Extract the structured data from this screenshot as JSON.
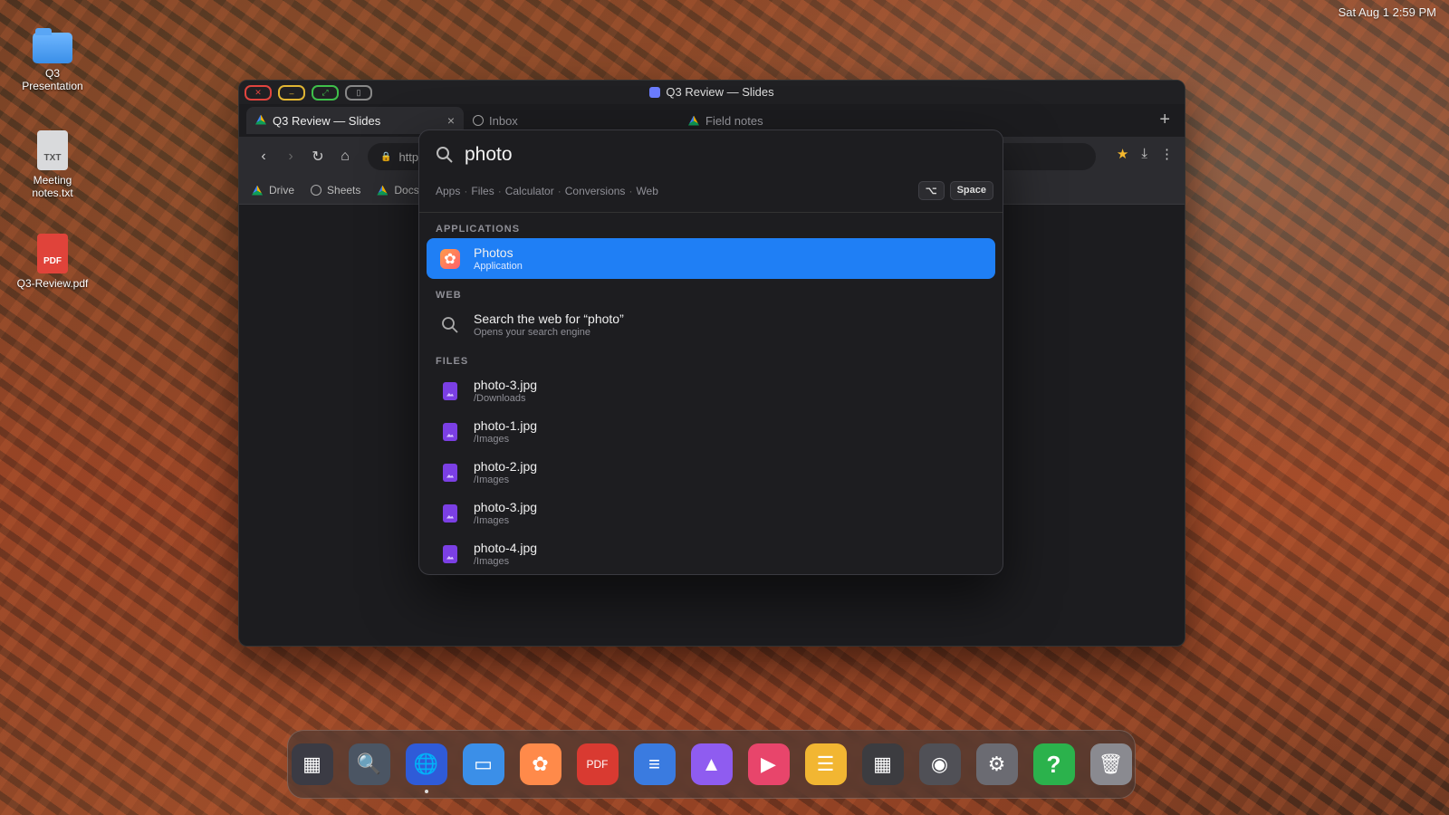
{
  "menubar": {
    "clock": "Sat Aug 1 2:59 PM"
  },
  "desktop": {
    "icons": [
      {
        "label": "Q3 Presentation",
        "kind": "folder"
      },
      {
        "label": "Meeting notes.txt",
        "kind": "txt",
        "badge": "TXT"
      },
      {
        "label": "Q3-Review.pdf",
        "kind": "pdf",
        "badge": "PDF"
      }
    ]
  },
  "window": {
    "title": "Q3 Review — Slides",
    "tabs": [
      {
        "label": "Q3 Review — Slides",
        "icon": "google-drive-icon"
      },
      {
        "label": "Inbox",
        "icon": "globe-icon"
      },
      {
        "label": "Field notes",
        "icon": "google-drive-icon"
      }
    ],
    "url": "https:",
    "bookmarks": [
      {
        "label": "Drive",
        "icon": "google-drive-icon"
      },
      {
        "label": "Sheets",
        "icon": "globe-icon"
      },
      {
        "label": "Docs",
        "icon": "google-drive-icon"
      }
    ]
  },
  "spotlight": {
    "query": "photo",
    "filters": [
      "Apps",
      "Files",
      "Calculator",
      "Conversions",
      "Web"
    ],
    "shortcut": {
      "modifier": "⌥",
      "key": "Space"
    },
    "sections": {
      "applications": "APPLICATIONS",
      "web": "WEB",
      "files": "FILES"
    },
    "app_result": {
      "title": "Photos",
      "subtitle": "Application"
    },
    "web_result": {
      "title": "Search the web for “photo”",
      "subtitle": "Opens your search engine"
    },
    "file_results": [
      {
        "name": "photo-3.jpg",
        "path": "/Downloads"
      },
      {
        "name": "photo-1.jpg",
        "path": "/Images"
      },
      {
        "name": "photo-2.jpg",
        "path": "/Images"
      },
      {
        "name": "photo-3.jpg",
        "path": "/Images"
      },
      {
        "name": "photo-4.jpg",
        "path": "/Images"
      }
    ],
    "accent": "#1f7ff5"
  },
  "dock": {
    "items": [
      {
        "name": "launchpad-icon",
        "glyph": "▦",
        "color": "#3b3b44"
      },
      {
        "name": "finder-search-icon",
        "glyph": "🔍",
        "color": "#4b5563"
      },
      {
        "name": "browser-globe-icon",
        "glyph": "🌐",
        "color": "#2f5bd8"
      },
      {
        "name": "files-folder-icon",
        "glyph": "▭",
        "color": "#3b8fe8"
      },
      {
        "name": "photos-icon",
        "glyph": "✿",
        "color": "#ff8a4a"
      },
      {
        "name": "pdf-reader-icon",
        "glyph": "PDF",
        "color": "#d93a31"
      },
      {
        "name": "documents-icon",
        "glyph": "≡",
        "color": "#3a7be0"
      },
      {
        "name": "image-viewer-icon",
        "glyph": "▲",
        "color": "#8f5cf0"
      },
      {
        "name": "media-player-icon",
        "glyph": "▶",
        "color": "#e8456b"
      },
      {
        "name": "notes-icon",
        "glyph": "☰",
        "color": "#f2b632"
      },
      {
        "name": "calculator-icon",
        "glyph": "▦",
        "color": "#3c3c40"
      },
      {
        "name": "camera-icon",
        "glyph": "◉",
        "color": "#505056"
      },
      {
        "name": "settings-gear-icon",
        "glyph": "⚙",
        "color": "#6b6b72"
      },
      {
        "name": "help-icon",
        "glyph": "?",
        "color": "#2bb24c"
      },
      {
        "name": "trash-icon",
        "glyph": "🗑",
        "color": "#8a8a90"
      }
    ]
  }
}
